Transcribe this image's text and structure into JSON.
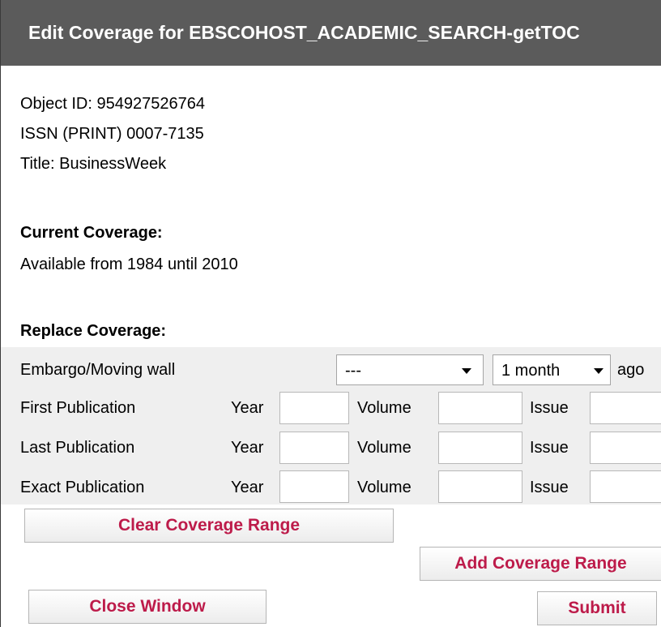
{
  "window": {
    "title": "Edit Coverage for EBSCOHOST_ACADEMIC_SEARCH-getTOC"
  },
  "info": {
    "object_id": "Object ID: 954927526764",
    "issn": "ISSN (PRINT) 0007-7135",
    "title": "Title: BusinessWeek"
  },
  "current": {
    "heading": "Current Coverage:",
    "text": "Available from 1984 until 2010"
  },
  "replace": {
    "heading": "Replace Coverage:",
    "embargo": {
      "label": "Embargo/Moving wall",
      "select1": "---",
      "select2": "1 month",
      "suffix": "ago"
    },
    "rows": [
      {
        "label": "First Publication",
        "year": "Year",
        "volume": "Volume",
        "issue": "Issue"
      },
      {
        "label": "Last Publication",
        "year": "Year",
        "volume": "Volume",
        "issue": "Issue"
      },
      {
        "label": "Exact Publication",
        "year": "Year",
        "volume": "Volume",
        "issue": "Issue"
      }
    ]
  },
  "buttons": {
    "clear": "Clear Coverage Range",
    "add": "Add Coverage Range",
    "close": "Close Window",
    "submit": "Submit"
  },
  "colors": {
    "title_bar": "#5b5b5b",
    "button_text": "#bd1b4a",
    "band": "#efefef"
  }
}
